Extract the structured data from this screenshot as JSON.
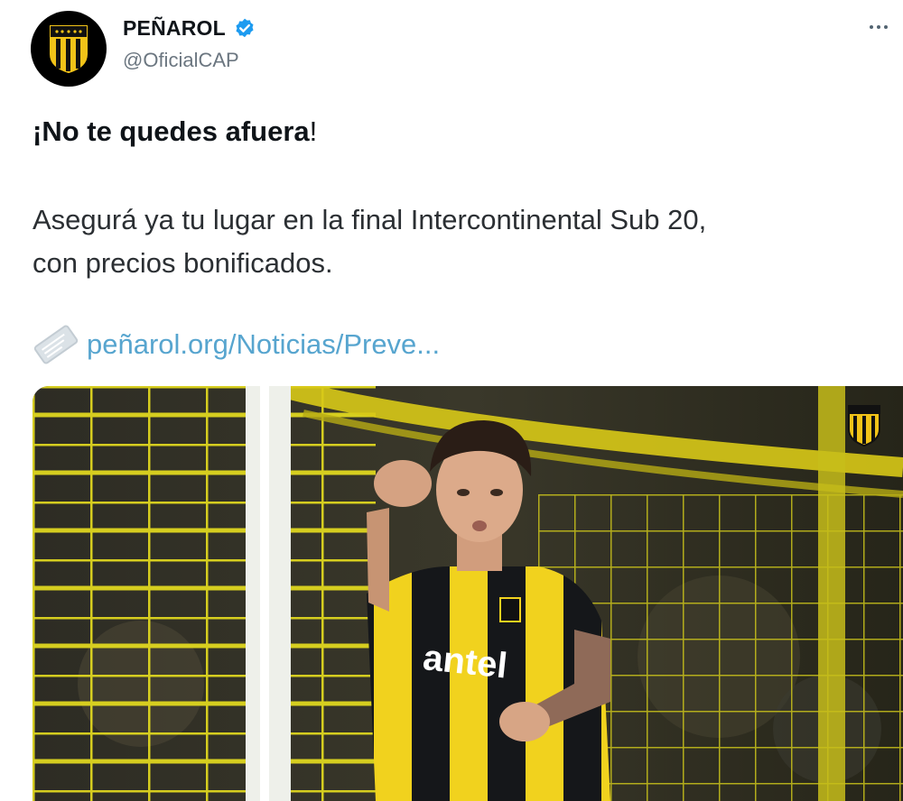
{
  "tweet": {
    "display_name": "PEÑAROL",
    "handle": "@OficialCAP",
    "heading": "¡No te quedes afuera",
    "heading_excl": "!",
    "body_line1": "Asegurá ya tu lugar en la final Intercontinental Sub 20,",
    "body_line2": "con precios bonificados.",
    "link_text": "peñarol.org/Noticias/Preve...",
    "jersey_sponsor": "antel"
  },
  "icons": {
    "verified": "verified-badge-icon",
    "more": "more-options-icon",
    "link": "link-card-icon",
    "crest": "club-crest-icon"
  },
  "colors": {
    "verified_blue": "#1d9bf0",
    "link_blue": "#57a5cf",
    "club_yellow": "#f2d21b",
    "club_black": "#111111",
    "handle_gray": "#6b7680"
  }
}
